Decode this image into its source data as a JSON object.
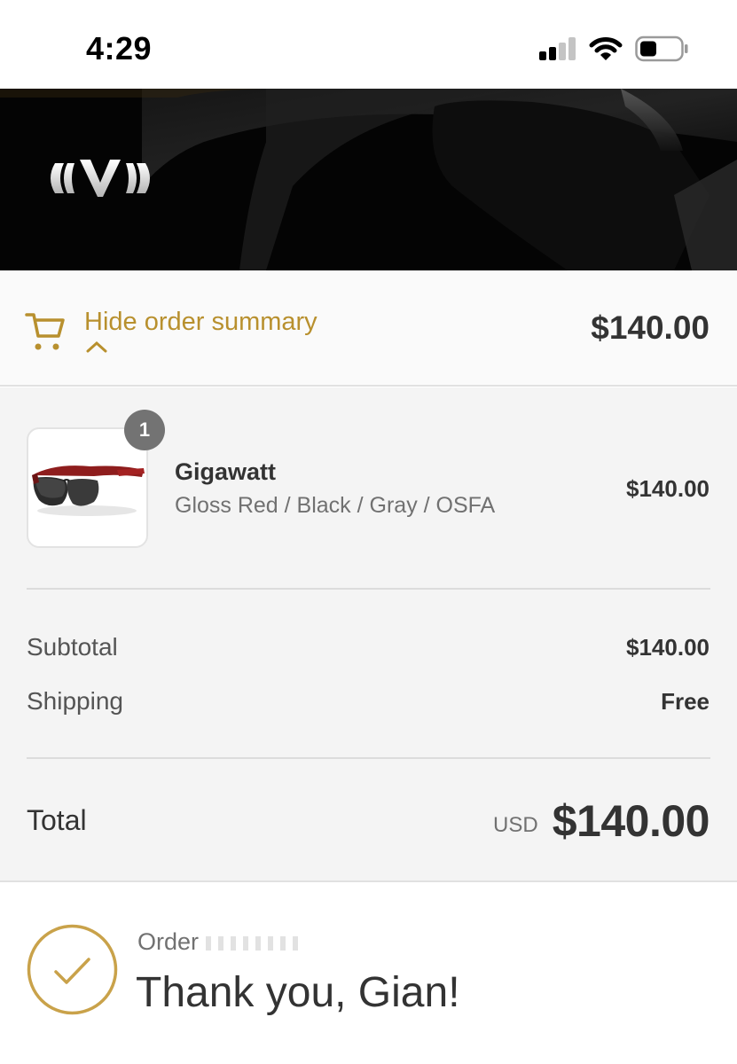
{
  "status_bar": {
    "time": "4:29",
    "icons": [
      "cellular-signal-icon",
      "wifi-icon",
      "battery-icon"
    ]
  },
  "header": {
    "logo_name": "brand-logo",
    "background": "dark-car-photo"
  },
  "summary_toggle": {
    "label": "Hide order summary",
    "total": "$140.00",
    "icon": "cart-icon",
    "accent_color": "#b8902e"
  },
  "line_items": [
    {
      "name": "Gigawatt",
      "variant": "Gloss Red / Black / Gray / OSFA",
      "price": "$140.00",
      "quantity": "1",
      "image": "red-sunglasses"
    }
  ],
  "totals": {
    "subtotal_label": "Subtotal",
    "subtotal_value": "$140.00",
    "shipping_label": "Shipping",
    "shipping_value": "Free",
    "total_label": "Total",
    "currency": "USD",
    "total_value": "$140.00"
  },
  "confirmation": {
    "order_label": "Order",
    "title": "Thank you, Gian!",
    "icon": "check-circle-icon"
  }
}
